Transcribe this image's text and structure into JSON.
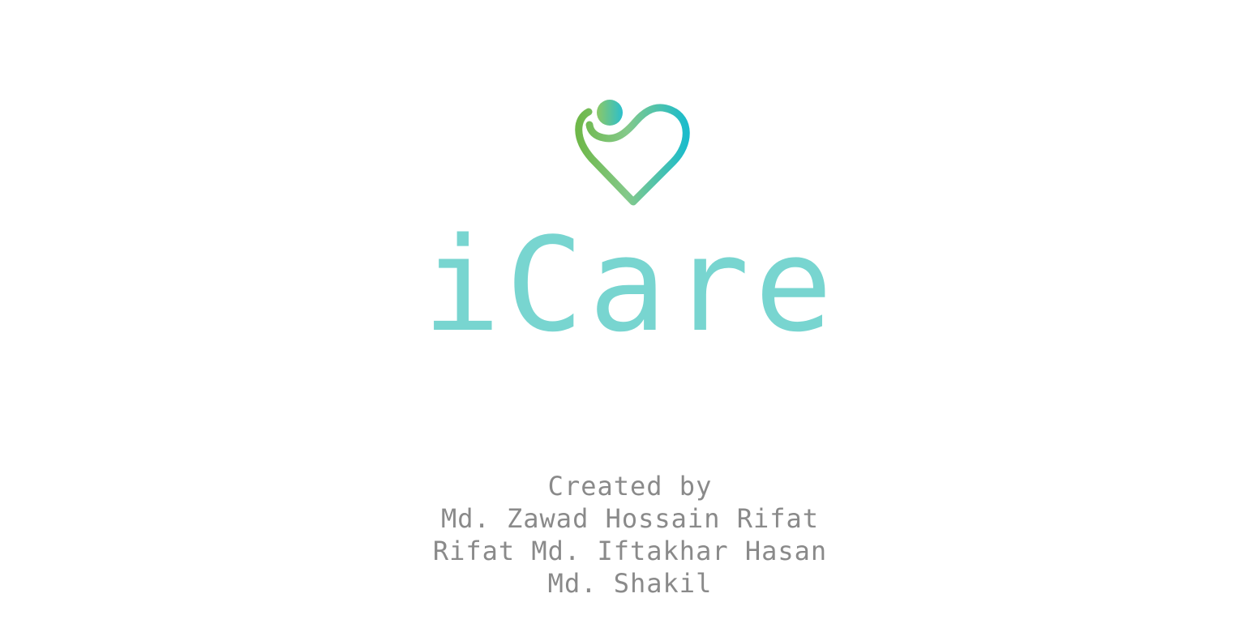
{
  "app": {
    "title": "iCare",
    "logo_icon": "heart-person-icon",
    "colors": {
      "title": "#78d5d0",
      "logo_green": "#7cc15a",
      "logo_teal": "#1cbccb",
      "credits_text": "#8a8a8a",
      "background": "#ffffff"
    }
  },
  "credits": {
    "heading": "Created by",
    "authors": [
      "Md. Zawad Hossain Rifat",
      "Rifat Md. Iftakhar Hasan",
      "Md. Shakil"
    ]
  }
}
